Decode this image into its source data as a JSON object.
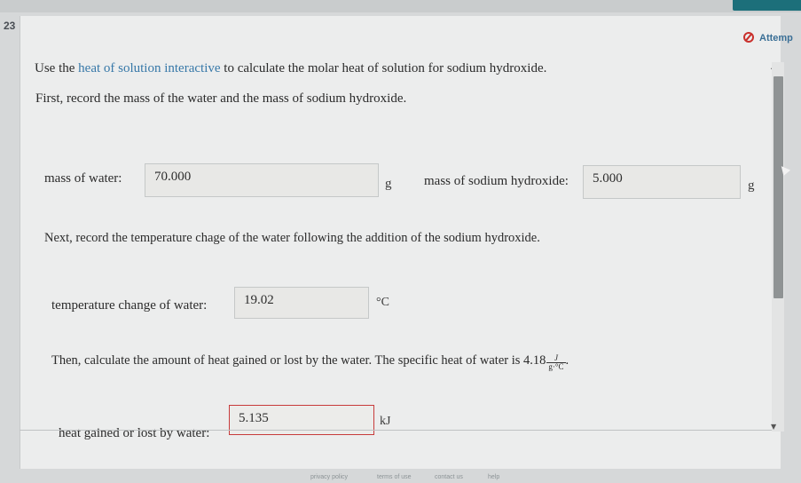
{
  "question": {
    "number": "23",
    "nav_chevron": ">"
  },
  "status": {
    "attempt_label": "Attemp",
    "icon": "no-entry-icon"
  },
  "instructions": {
    "line1_prefix": "Use the ",
    "line1_link": "heat of solution interactive",
    "line1_suffix": " to calculate the molar heat of solution for sodium hydroxide.",
    "line2": "First, record the mass of the water and the mass of sodium hydroxide.",
    "line3": "Next, record the temperature chage of the water following the addition of the sodium hydroxide.",
    "line4_prefix": "Then, calculate the amount of heat gained or lost by the water. The specific heat of water is 4.18",
    "line4_unit_num": "J",
    "line4_unit_den": "g·°C",
    "line4_suffix": "."
  },
  "fields": {
    "mass_water": {
      "label": "mass of water:",
      "value": "70.000",
      "unit": "g"
    },
    "mass_naoh": {
      "label": "mass of sodium hydroxide:",
      "value": "5.000",
      "unit": "g"
    },
    "temp_change": {
      "label": "temperature change of water:",
      "value": "19.02",
      "unit": "°C"
    },
    "heat": {
      "label": "heat gained or lost by water:",
      "value": "5.135",
      "unit": "kJ"
    }
  },
  "footer": {
    "links": [
      "privacy policy",
      "terms of use",
      "contact us",
      "help"
    ]
  },
  "colors": {
    "link": "#3778a8",
    "teal_accent": "#1c6f7a",
    "error_border": "#c73b3b",
    "attempt_text": "#3a6f96"
  }
}
